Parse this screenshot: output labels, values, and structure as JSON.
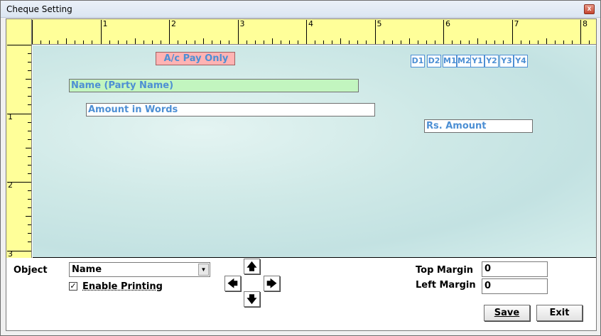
{
  "window": {
    "title": "Cheque Setting",
    "close_glyph": "x"
  },
  "ruler": {
    "top_labels": [
      "1",
      "2",
      "3",
      "4",
      "5",
      "6",
      "7",
      "8"
    ],
    "left_labels": [
      "1",
      "2",
      "3"
    ]
  },
  "fields": {
    "ac_pay": "A/c Pay Only",
    "name": "Name (Party Name)",
    "amount_words": "Amount in Words",
    "rs_amount": "Rs. Amount",
    "date_boxes": [
      "D1",
      "D2",
      "M1",
      "M2",
      "Y1",
      "Y2",
      "Y3",
      "Y4"
    ]
  },
  "controls": {
    "object_label": "Object",
    "object_value": "Name",
    "enable_printing_label": "Enable Printing",
    "enable_printing_checked": "✓",
    "arrows": {
      "up": "🡅",
      "left": "🡄",
      "right": "🡆",
      "down": "🡇"
    },
    "top_margin_label": "Top Margin",
    "top_margin_value": "0",
    "left_margin_label": "Left Margin",
    "left_margin_value": "0",
    "save_label": "Save",
    "exit_label": "Exit"
  }
}
